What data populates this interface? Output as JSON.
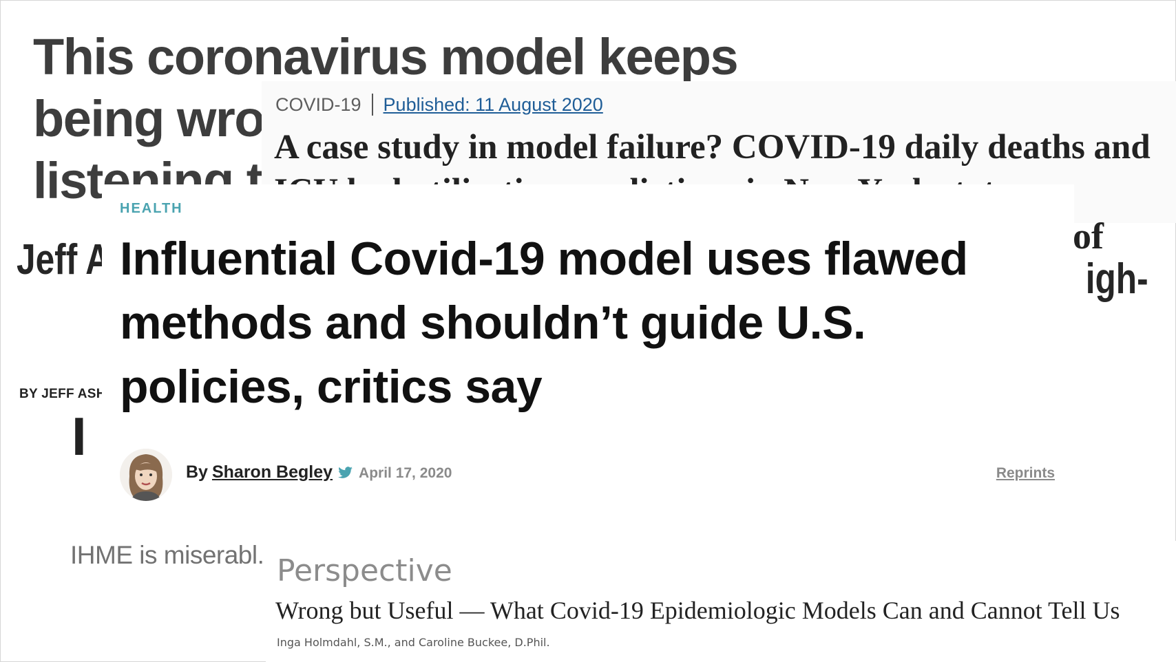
{
  "layer_1": {
    "headline": "This coronavirus model keeps being wrong. Why are we still listening to it?"
  },
  "layer_2": {
    "headline": "Jeff A... profi...",
    "byline": "BY JEFF ASH",
    "big_text": "I IH",
    "paragraph": "IHME is miserabl... heading. See if yo..."
  },
  "layer_2_edge": {
    "text": "igh-"
  },
  "layer_3": {
    "tag": "COVID-19",
    "published": "Published: 11 August 2020",
    "title": "A case study in model failure? COVID-19 daily deaths and ICU bed utilisation predictions in New York state",
    "edge_text": "of"
  },
  "layer_4": {
    "kicker": "HEALTH",
    "title": "Influential Covid-19 model uses flawed methods and shouldn’t guide U.S. policies, critics say",
    "by": "By",
    "author": "Sharon Begley",
    "date": "April 17, 2020",
    "reprints": "Reprints",
    "twitter_icon": "twitter-bird",
    "accent_color": "#4aa3b0"
  },
  "layer_5": {
    "kicker": "Perspective",
    "title": "Wrong but Useful — What Covid-19 Epidemiologic Models Can and Cannot Tell Us",
    "authors": "Inga Holmdahl, S.M., and Caroline Buckee, D.Phil."
  }
}
